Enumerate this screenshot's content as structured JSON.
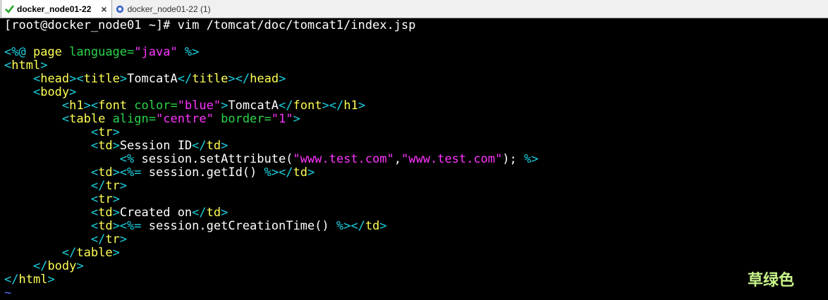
{
  "tabs": [
    {
      "label": "docker_node01-22",
      "active": true,
      "icon": "check-icon"
    },
    {
      "label": "docker_node01-22 (1)",
      "active": false,
      "icon": "session-icon"
    }
  ],
  "tab_close_glyph": "×",
  "terminal": {
    "prompt_line": "[root@docker_node01 ~]# vim /tomcat/doc/tomcat1/index.jsp",
    "lines": [
      [],
      [
        [
          "tag",
          "<%@ "
        ],
        [
          "name",
          "page "
        ],
        [
          "attr",
          "language="
        ],
        [
          "str",
          "\"java\""
        ],
        [
          "tag",
          " %>"
        ]
      ],
      [
        [
          "tag",
          "<"
        ],
        [
          "name",
          "html"
        ],
        [
          "tag",
          ">"
        ]
      ],
      [
        [
          "text",
          "    "
        ],
        [
          "tag",
          "<"
        ],
        [
          "name",
          "head"
        ],
        [
          "tag",
          "><"
        ],
        [
          "name",
          "title"
        ],
        [
          "tag",
          ">"
        ],
        [
          "text",
          "TomcatA"
        ],
        [
          "tag",
          "</"
        ],
        [
          "name",
          "title"
        ],
        [
          "tag",
          "></"
        ],
        [
          "name",
          "head"
        ],
        [
          "tag",
          ">"
        ]
      ],
      [
        [
          "text",
          "    "
        ],
        [
          "tag",
          "<"
        ],
        [
          "name",
          "body"
        ],
        [
          "tag",
          ">"
        ]
      ],
      [
        [
          "text",
          "        "
        ],
        [
          "tag",
          "<"
        ],
        [
          "name",
          "h1"
        ],
        [
          "tag",
          "><"
        ],
        [
          "name",
          "font "
        ],
        [
          "attr",
          "color="
        ],
        [
          "str",
          "\"blue\""
        ],
        [
          "tag",
          ">"
        ],
        [
          "text",
          "TomcatA"
        ],
        [
          "tag",
          "</"
        ],
        [
          "name",
          "font"
        ],
        [
          "tag",
          "></"
        ],
        [
          "name",
          "h1"
        ],
        [
          "tag",
          ">"
        ]
      ],
      [
        [
          "text",
          "        "
        ],
        [
          "tag",
          "<"
        ],
        [
          "name",
          "table "
        ],
        [
          "attr",
          "align="
        ],
        [
          "str",
          "\"centre\" "
        ],
        [
          "attr",
          "border="
        ],
        [
          "str",
          "\"1\""
        ],
        [
          "tag",
          ">"
        ]
      ],
      [
        [
          "text",
          "            "
        ],
        [
          "tag",
          "<"
        ],
        [
          "name",
          "tr"
        ],
        [
          "tag",
          ">"
        ]
      ],
      [
        [
          "text",
          "            "
        ],
        [
          "tag",
          "<"
        ],
        [
          "name",
          "td"
        ],
        [
          "tag",
          ">"
        ],
        [
          "text",
          "Session ID"
        ],
        [
          "tag",
          "</"
        ],
        [
          "name",
          "td"
        ],
        [
          "tag",
          ">"
        ]
      ],
      [
        [
          "text",
          "                "
        ],
        [
          "tag",
          "<%"
        ],
        [
          "text",
          " session.setAttribute("
        ],
        [
          "str",
          "\"www.test.com\""
        ],
        [
          "text",
          ","
        ],
        [
          "str",
          "\"www.test.com\""
        ],
        [
          "text",
          "); "
        ],
        [
          "tag",
          "%>"
        ]
      ],
      [
        [
          "text",
          "            "
        ],
        [
          "tag",
          "<"
        ],
        [
          "name",
          "td"
        ],
        [
          "tag",
          "><%="
        ],
        [
          "text",
          " session.getId() "
        ],
        [
          "tag",
          "%></"
        ],
        [
          "name",
          "td"
        ],
        [
          "tag",
          ">"
        ]
      ],
      [
        [
          "text",
          "            "
        ],
        [
          "tag",
          "</"
        ],
        [
          "name",
          "tr"
        ],
        [
          "tag",
          ">"
        ]
      ],
      [
        [
          "text",
          "            "
        ],
        [
          "tag",
          "<"
        ],
        [
          "name",
          "tr"
        ],
        [
          "tag",
          ">"
        ]
      ],
      [
        [
          "text",
          "            "
        ],
        [
          "tag",
          "<"
        ],
        [
          "name",
          "td"
        ],
        [
          "tag",
          ">"
        ],
        [
          "text",
          "Created on"
        ],
        [
          "tag",
          "</"
        ],
        [
          "name",
          "td"
        ],
        [
          "tag",
          ">"
        ]
      ],
      [
        [
          "text",
          "            "
        ],
        [
          "tag",
          "<"
        ],
        [
          "name",
          "td"
        ],
        [
          "tag",
          "><%="
        ],
        [
          "text",
          " session.getCreationTime() "
        ],
        [
          "tag",
          "%></"
        ],
        [
          "name",
          "td"
        ],
        [
          "tag",
          ">"
        ]
      ],
      [
        [
          "text",
          "            "
        ],
        [
          "tag",
          "</"
        ],
        [
          "name",
          "tr"
        ],
        [
          "tag",
          ">"
        ]
      ],
      [
        [
          "text",
          "        "
        ],
        [
          "tag",
          "</"
        ],
        [
          "name",
          "table"
        ],
        [
          "tag",
          ">"
        ]
      ],
      [
        [
          "text",
          "    "
        ],
        [
          "tag",
          "</"
        ],
        [
          "name",
          "body"
        ],
        [
          "tag",
          ">"
        ]
      ],
      [
        [
          "tag",
          "</"
        ],
        [
          "name",
          "html"
        ],
        [
          "tag",
          ">"
        ]
      ],
      [
        [
          "tilde",
          "~"
        ]
      ]
    ]
  },
  "watermark": "草绿色",
  "colors": {
    "tag": "#1ad1e0",
    "name": "#ffff54",
    "attr": "#2ad44a",
    "str": "#ff35ff",
    "text": "#ffffff",
    "tilde": "#4f6fff",
    "background": "#000000"
  }
}
